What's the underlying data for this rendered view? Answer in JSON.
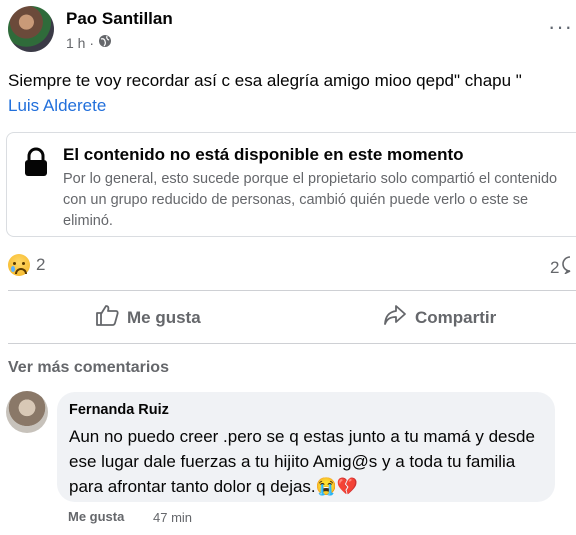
{
  "post": {
    "author": "Pao Santillan",
    "time": "1 h ·",
    "more": "···",
    "text": "Siempre te voy recordar así c esa alegría amigo mioo qepd\" chapu \"",
    "tag": "Luis Alderete"
  },
  "unavailable": {
    "title": "El contenido no está disponible en este momento",
    "body": "Por lo general, esto sucede porque el propietario solo compartió el contenido con un grupo reducido de personas, cambió quién puede verlo o este se eliminó."
  },
  "reactions": {
    "count": "2",
    "comments": "2"
  },
  "actions": {
    "like": "Me gusta",
    "share": "Compartir"
  },
  "more_comments": "Ver más comentarios",
  "comment": {
    "name": "Fernanda Ruiz",
    "text": "Aun no puedo creer .pero se q estas junto a tu mamá y desde ese lugar dale fuerzas a tu hijito Amig@s y a toda tu familia para afrontar tanto dolor q dejas.😭💔",
    "like": "Me gusta",
    "time": "47 min"
  },
  "icons": [
    "globe-icon",
    "more-icon",
    "lock-icon",
    "sad-reaction-icon",
    "comment-icon",
    "like-icon",
    "share-icon"
  ]
}
